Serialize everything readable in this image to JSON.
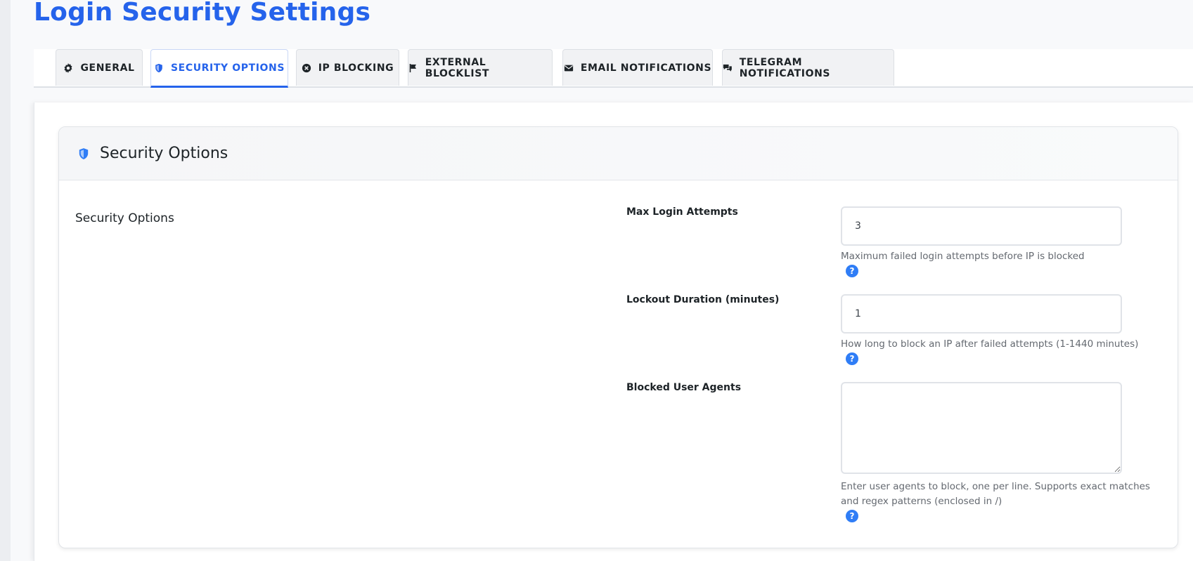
{
  "page": {
    "title": "Login Security Settings"
  },
  "tabs": [
    {
      "label": "GENERAL",
      "icon": "gear-icon",
      "active": false
    },
    {
      "label": "SECURITY OPTIONS",
      "icon": "shield-icon",
      "active": true
    },
    {
      "label": "IP BLOCKING",
      "icon": "x-circle-icon",
      "active": false
    },
    {
      "label": "EXTERNAL BLOCKLIST",
      "icon": "flag-icon",
      "active": false
    },
    {
      "label": "EMAIL NOTIFICATIONS",
      "icon": "envelope-icon",
      "active": false
    },
    {
      "label": "TELEGRAM NOTIFICATIONS",
      "icon": "chat-bubbles-icon",
      "active": false
    }
  ],
  "card": {
    "title": "Security Options",
    "icon": "shield-icon",
    "section_label": "Security Options"
  },
  "fields": {
    "max_login_attempts": {
      "label": "Max Login Attempts",
      "value": "3",
      "help": "Maximum failed login attempts before IP is blocked",
      "help_icon": "?"
    },
    "lockout_duration": {
      "label": "Lockout Duration (minutes)",
      "value": "1",
      "help": "How long to block an IP after failed attempts (1-1440 minutes)",
      "help_icon": "?"
    },
    "blocked_user_agents": {
      "label": "Blocked User Agents",
      "value": "",
      "help": "Enter user agents to block, one per line. Supports exact matches and regex patterns (enclosed in /)",
      "help_icon": "?"
    }
  },
  "colors": {
    "accent": "#2563eb",
    "help_icon": "#2f7df6",
    "text": "#1d2327",
    "muted": "#646970"
  }
}
